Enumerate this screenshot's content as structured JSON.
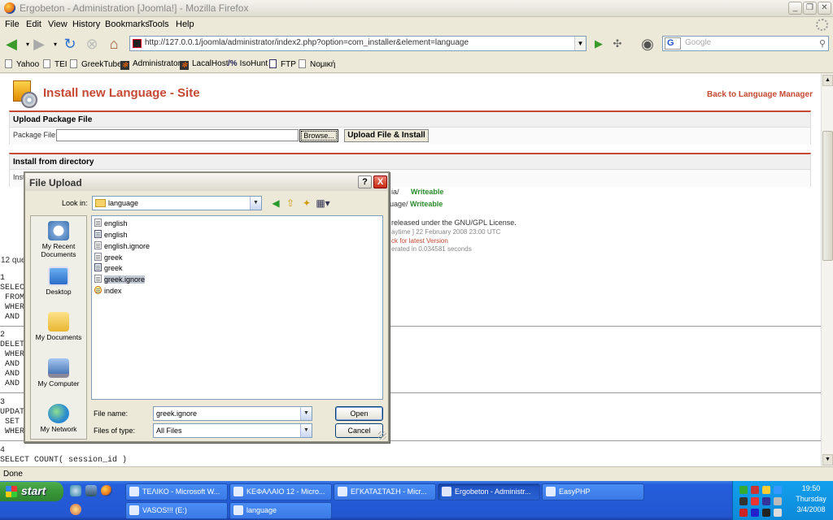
{
  "window": {
    "title": "Ergobeton - Administration [Joomla!] - Mozilla Firefox"
  },
  "menu": [
    "File",
    "Edit",
    "View",
    "History",
    "Bookmarks",
    "Tools",
    "Help"
  ],
  "navbar": {
    "url": "http://127.0.0.1/joomla/administrator/index2.php?option=com_installer&element=language",
    "search_engine_letter": "G",
    "search_placeholder": "Google"
  },
  "bookmarks": [
    "Yahoo",
    "TEI",
    "GreekTube",
    "Administrator",
    "LacalHost",
    "IsoHunt",
    "FTP",
    "Νομική"
  ],
  "page": {
    "title": "Install new Language - Site",
    "back_link": "Back to Language Manager",
    "upload_section_title": "Upload Package File",
    "package_file_label": "Package File:",
    "browse_label": "Browse...",
    "upload_install_label": "Upload File & Install",
    "install_dir_title": "Install from directory",
    "install_dir_row_label": "Inst",
    "bg_lines": {
      "path1": "ia/",
      "path2": "uage/",
      "writeable": "Writeable",
      "license": "released under the GNU/GPL License.",
      "date": "aytime ] 22 February 2008 23:00 UTC",
      "check": "ck for latest Version",
      "generated": "erated in 0.034581 seconds",
      "queries": "12 que"
    },
    "sql": {
      "q1_num": "1",
      "q1_lines": "SELECT\n FROM\n WHER\n AND i",
      "q2_num": "2",
      "q2_lines": "DELET\n WHER\n AND\n AND\n AND",
      "q3_num": "3",
      "q3_lines": "UPDAT\n SET\n WHER",
      "q4_num": "4",
      "q4_line": "SELECT COUNT( session_id )"
    }
  },
  "dialog": {
    "title": "File Upload",
    "help": "?",
    "close": "X",
    "look_in_label": "Look in:",
    "look_in_value": "language",
    "places": [
      "My Recent Documents",
      "Desktop",
      "My Documents",
      "My Computer",
      "My Network"
    ],
    "files": [
      {
        "name": "english",
        "kind": "doc"
      },
      {
        "name": "english",
        "kind": "php"
      },
      {
        "name": "english.ignore",
        "kind": "doc"
      },
      {
        "name": "greek",
        "kind": "doc"
      },
      {
        "name": "greek",
        "kind": "php"
      },
      {
        "name": "greek.ignore",
        "kind": "doc",
        "selected": true
      },
      {
        "name": "index",
        "kind": "htm"
      }
    ],
    "file_name_label": "File name:",
    "file_name_value": "greek.ignore",
    "file_type_label": "Files of type:",
    "file_type_value": "All Files",
    "open_label": "Open",
    "cancel_label": "Cancel"
  },
  "status": "Done",
  "taskbar": {
    "start_label": "start",
    "tasks_row1": [
      "ΤΕΛΙΚΟ - Microsoft W...",
      "ΚΕΦΑΛΑΙΟ 12 - Micro...",
      "ΕΓΚΑΤΑΣΤΑΣΗ - Micr...",
      "Ergobeton - Administr...",
      "EasyPHP"
    ],
    "tasks_row2": [
      "VASOS!!! (E:)",
      "language"
    ],
    "active_task": "Ergobeton - Administr...",
    "clock_time": "19:50",
    "clock_day": "Thursday",
    "clock_date": "3/4/2008"
  }
}
